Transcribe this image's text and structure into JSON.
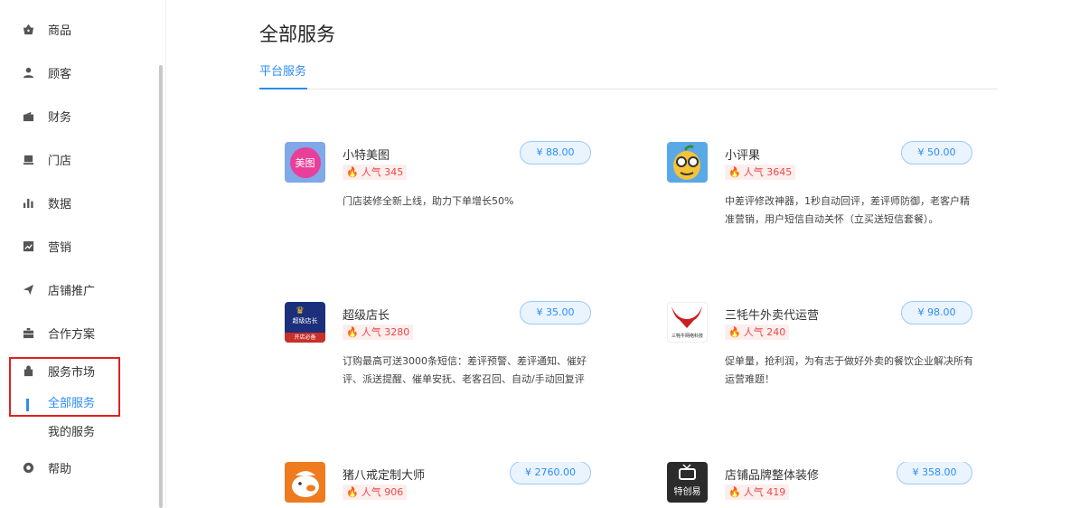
{
  "sidebar": {
    "items": [
      {
        "label": "商品",
        "icon": "bag-icon"
      },
      {
        "label": "顾客",
        "icon": "user-icon"
      },
      {
        "label": "财务",
        "icon": "wallet-icon"
      },
      {
        "label": "门店",
        "icon": "store-icon"
      },
      {
        "label": "数据",
        "icon": "bar-chart-icon"
      },
      {
        "label": "营销",
        "icon": "trend-icon"
      },
      {
        "label": "店铺推广",
        "icon": "send-icon"
      },
      {
        "label": "合作方案",
        "icon": "briefcase-icon"
      },
      {
        "label": "服务市场",
        "icon": "market-bag-icon"
      },
      {
        "label": "帮助",
        "icon": "help-icon"
      }
    ],
    "sub_items": [
      {
        "label": "全部服务",
        "active": true
      },
      {
        "label": "我的服务",
        "active": false
      }
    ]
  },
  "main": {
    "title": "全部服务",
    "tabs": [
      {
        "label": "平台服务",
        "active": true
      }
    ],
    "services": [
      {
        "name": "小特美图",
        "popularity": "人气 345",
        "price": "¥ 88.00",
        "desc": "门店装修全新上线，助力下单增长50%",
        "thumb_text": "美图"
      },
      {
        "name": "小评果",
        "popularity": "人气 3645",
        "price": "¥ 50.00",
        "desc": "中差评修改神器，1秒自动回评，差评师防御，老客户精准营销，用户短信自动关怀（立买送短信套餐）。",
        "thumb_text": ""
      },
      {
        "name": "超级店长",
        "popularity": "人气 3280",
        "price": "¥ 35.00",
        "desc": "订购最高可送3000条短信：差评预警、差评通知、催好评、派送提醒、催单安抚、老客召回、自动/手动回复评",
        "thumb_text": "超级店长",
        "thumb_sub": "开店必备"
      },
      {
        "name": "三牦牛外卖代运营",
        "popularity": "人气 240",
        "price": "¥ 98.00",
        "desc": "促单量，抢利润，为有志于做好外卖的餐饮企业解决所有运营难题！",
        "thumb_text": "三牦牛网络科技"
      },
      {
        "name": "猪八戒定制大师",
        "popularity": "人气 906",
        "price": "¥ 2760.00",
        "desc": "",
        "thumb_text": ""
      },
      {
        "name": "店铺品牌整体装修",
        "popularity": "人气 419",
        "price": "¥ 358.00",
        "desc": "",
        "thumb_text": "特创易"
      }
    ]
  },
  "colors": {
    "accent": "#2d8cf0",
    "popularity": "#e84a4a",
    "highlight_box": "#e02020"
  }
}
